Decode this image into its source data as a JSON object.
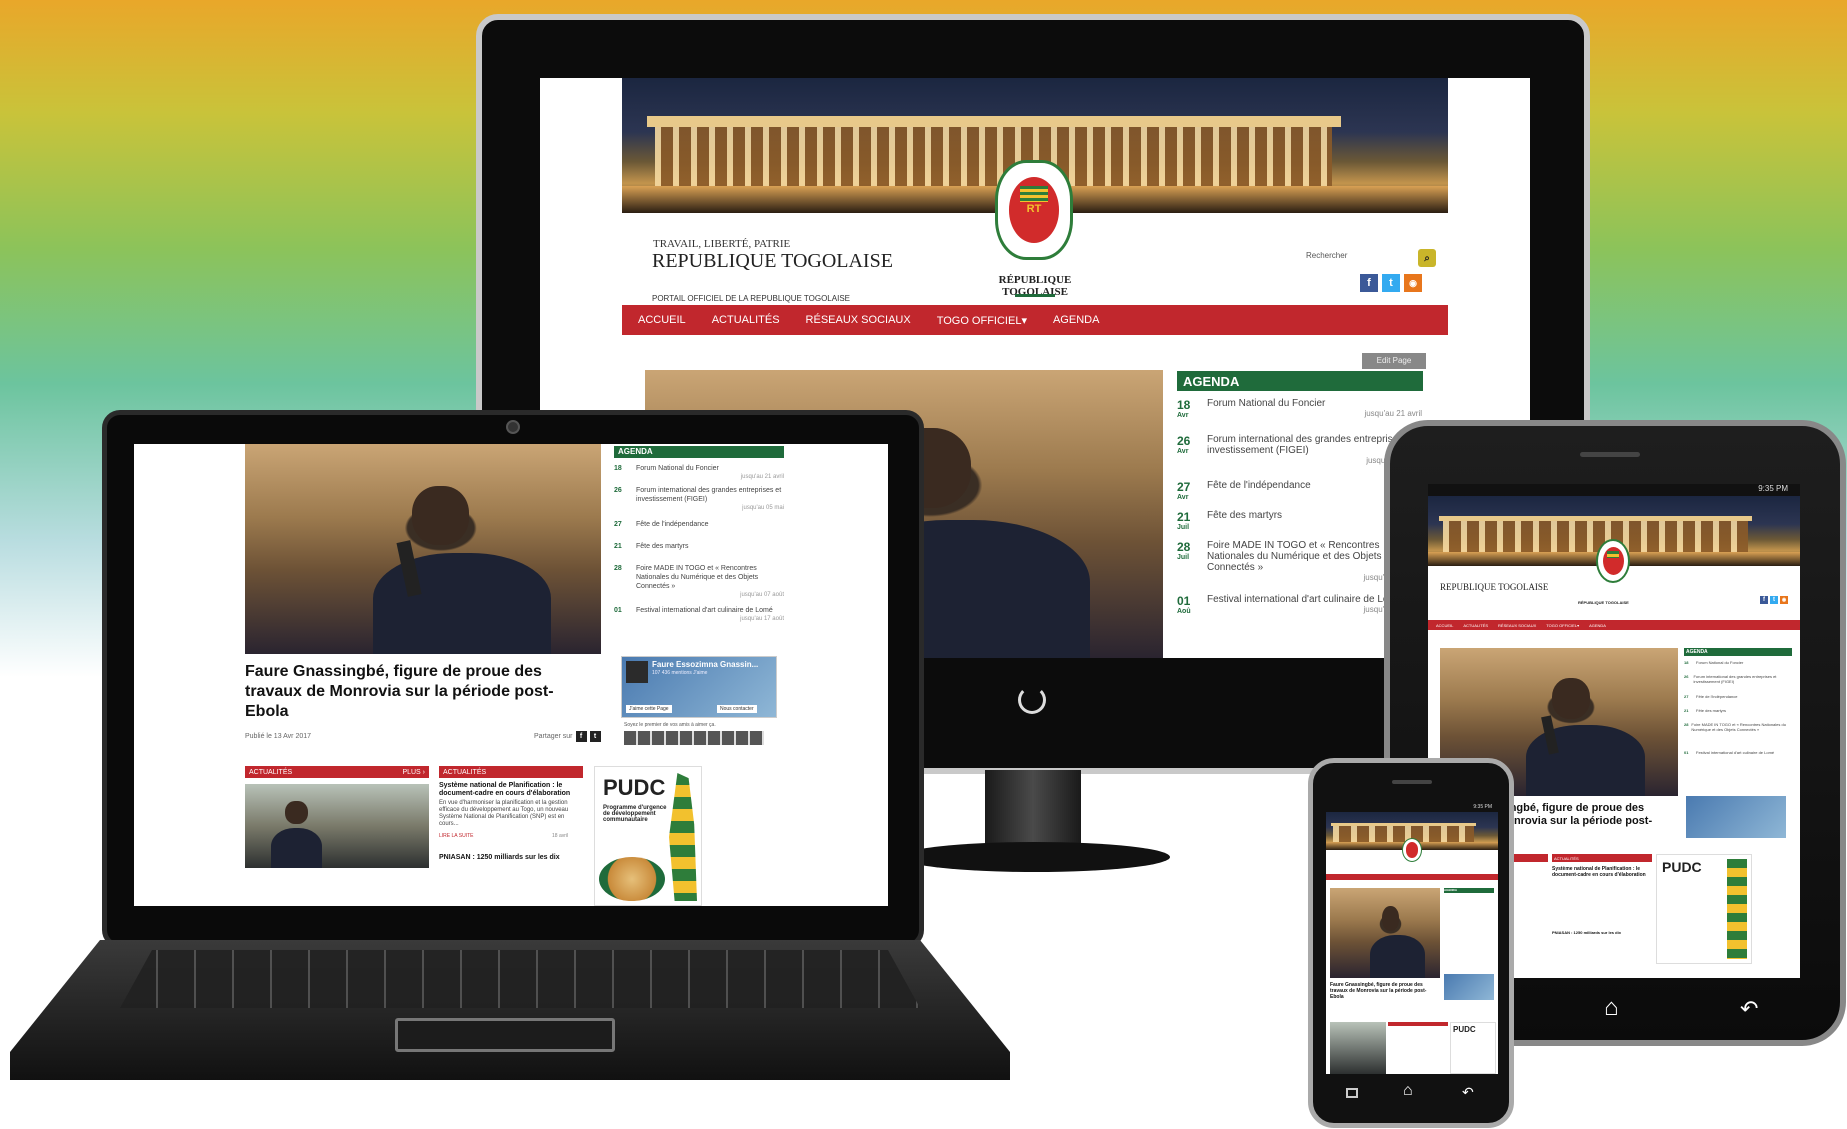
{
  "site": {
    "motto": "TRAVAIL, LIBERTÉ, PATRIE",
    "name": "REPUBLIQUE TOGOLAISE",
    "subtitle": "PORTAIL OFFICIEL DE LA REPUBLIQUE TOGOLAISE",
    "crest_caption": "RÉPUBLIQUE TOGOLAISE",
    "crest_badge": "RT",
    "search_placeholder": "Rechercher",
    "search_icon": "search-icon"
  },
  "nav": {
    "items": [
      "ACCUEIL",
      "ACTUALITÉS",
      "RÉSEAUX SOCIAUX",
      "TOGO OFFICIEL▾",
      "AGENDA"
    ]
  },
  "edit_page": "Edit Page",
  "social": [
    "f",
    "t",
    "rss"
  ],
  "agenda": {
    "title": "AGENDA",
    "events": [
      {
        "day": "18",
        "mon": "Avr",
        "title": "Forum National du Foncier",
        "until": "jusqu'au 21 avril"
      },
      {
        "day": "26",
        "mon": "Avr",
        "title": "Forum international des grandes entreprises et investissement (FIGEI)",
        "until": "jusqu'au 05 mai"
      },
      {
        "day": "27",
        "mon": "Avr",
        "title": "Fête de l'indépendance",
        "until": ""
      },
      {
        "day": "21",
        "mon": "Juil",
        "title": "Fête des martyrs",
        "until": ""
      },
      {
        "day": "28",
        "mon": "Juil",
        "title": "Foire MADE IN TOGO et « Rencontres Nationales du Numérique et des Objets Connectés »",
        "until": "jusqu'au 07 août"
      },
      {
        "day": "01",
        "mon": "Aoû",
        "title": "Festival international d'art culinaire de Lomé",
        "until": "jusqu'au 17 août"
      }
    ]
  },
  "headline": {
    "title": "Faure Gnassingbé, figure de proue des travaux de Monrovia sur la période post-Ebola",
    "published": "Publié le 13 Avr 2017",
    "share": "Partager sur"
  },
  "fb_widget": {
    "page": "Faure Essozimna Gnassin...",
    "likes": "107 436 mentions J'aime",
    "like_btn": "J'aime cette Page",
    "contact_btn": "Nous contacter",
    "friends": "Soyez le premier de vos amis à aimer ça."
  },
  "actualites": {
    "label": "ACTUALITÉS",
    "more": "PLUS ›",
    "story_title": "Système national de Planification : le document-cadre en cours d'élaboration",
    "story_body": "En vue d'harmoniser la planification et la gestion efficace du développement au Togo, un nouveau Système National de Planification (SNP) est en cours...",
    "read_more": "LIRE LA SUITE",
    "date": "18 avril",
    "story2": "PNIASAN : 1250 milliards sur les dix"
  },
  "pudc": {
    "title": "PUDC",
    "body": "Programme d'urgence de développement communautaire"
  },
  "tablet": {
    "time": "9:35 PM"
  },
  "colors": {
    "red": "#c1272d",
    "green": "#1f6b3b",
    "yellow": "#f2c12e"
  }
}
